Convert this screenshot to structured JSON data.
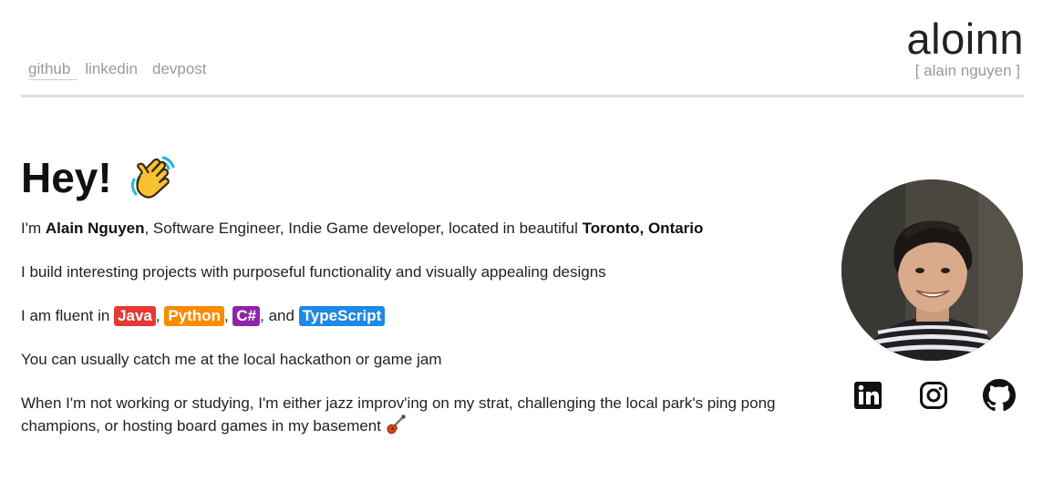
{
  "nav": {
    "links": [
      "github",
      "linkedin",
      "devpost"
    ]
  },
  "brand": {
    "name": "aloinn",
    "subtitle": "[ alain nguyen ]"
  },
  "intro": {
    "heading": "Hey!",
    "wave_icon": "waving-hand-emoji"
  },
  "paragraphs": {
    "p1": {
      "pre": "I'm ",
      "name": "Alain Nguyen",
      "mid": ", Software Engineer, Indie Game developer, located in beautiful ",
      "location": "Toronto, Ontario"
    },
    "p2": "I build interesting projects with purposeful functionality and visually appealing designs",
    "p3": {
      "pre": "I am fluent in ",
      "sep1": ", ",
      "sep2": ", ",
      "sep3": ", and ",
      "languages": [
        {
          "label": "Java",
          "color": "#e53935"
        },
        {
          "label": "Python",
          "color": "#fb8c00"
        },
        {
          "label": "C#",
          "color": "#8e24aa"
        },
        {
          "label": "TypeScript",
          "color": "#1e88e5"
        }
      ]
    },
    "p4": "You can usually catch me at the local hackathon or game jam",
    "p5": "When I'm not working or studying, I'm either jazz improv'ing on my strat, challenging the local park's ping pong champions, or hosting board games in my basement"
  },
  "social": {
    "icons": [
      "linkedin-icon",
      "instagram-icon",
      "github-icon"
    ]
  }
}
